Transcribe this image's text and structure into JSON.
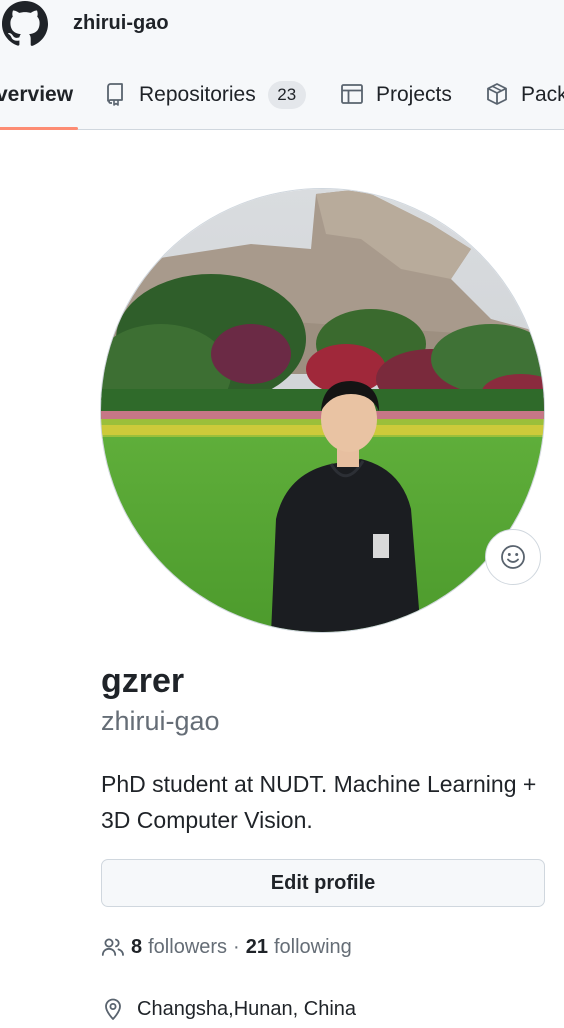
{
  "header": {
    "username": "zhirui-gao",
    "logo_icon": "github-mark-icon",
    "tabs": [
      {
        "label": "Overview",
        "visible_label": "verview",
        "icon": "book-open-icon",
        "selected": true
      },
      {
        "label": "Repositories",
        "count": "23",
        "icon": "repo-icon"
      },
      {
        "label": "Projects",
        "icon": "table-icon"
      },
      {
        "label": "Packages",
        "visible_label": "Pack",
        "icon": "package-icon"
      }
    ],
    "accent_color": "#fd8c73"
  },
  "profile": {
    "display_name": "gzrer",
    "login": "zhirui-gao",
    "bio": "PhD student at NUDT. Machine Learning + 3D Computer Vision.",
    "status_icon": "smiley-icon",
    "edit_button": "Edit profile",
    "followers_count": "8",
    "followers_label": "followers",
    "separator": "·",
    "following_count": "21",
    "following_label": "following",
    "location": "Changsha,Hunan, China"
  }
}
